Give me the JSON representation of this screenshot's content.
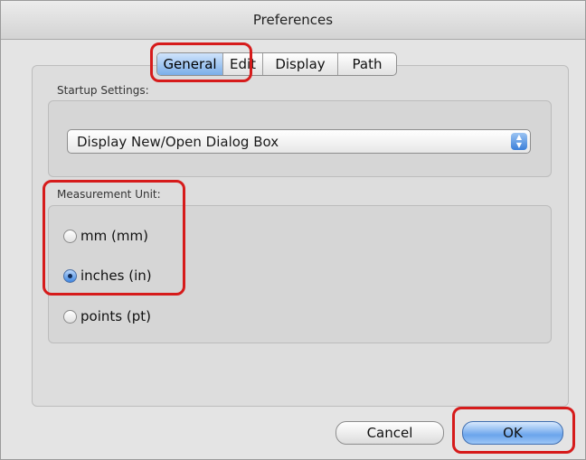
{
  "window": {
    "title": "Preferences"
  },
  "tabs": [
    {
      "label": "General",
      "active": true
    },
    {
      "label": "Edit",
      "active": false
    },
    {
      "label": "Display",
      "active": false
    },
    {
      "label": "Path",
      "active": false
    }
  ],
  "startup": {
    "label": "Startup Settings:",
    "selected_value": "Display New/Open Dialog Box"
  },
  "measurement": {
    "label": "Measurement Unit:",
    "options": [
      {
        "label": "mm (mm)",
        "checked": false
      },
      {
        "label": "inches (in)",
        "checked": true
      },
      {
        "label": "points (pt)",
        "checked": false
      }
    ]
  },
  "buttons": {
    "cancel": "Cancel",
    "ok": "OK"
  },
  "colors": {
    "accent": "#6ba5ec",
    "highlight": "#d61b1b"
  }
}
